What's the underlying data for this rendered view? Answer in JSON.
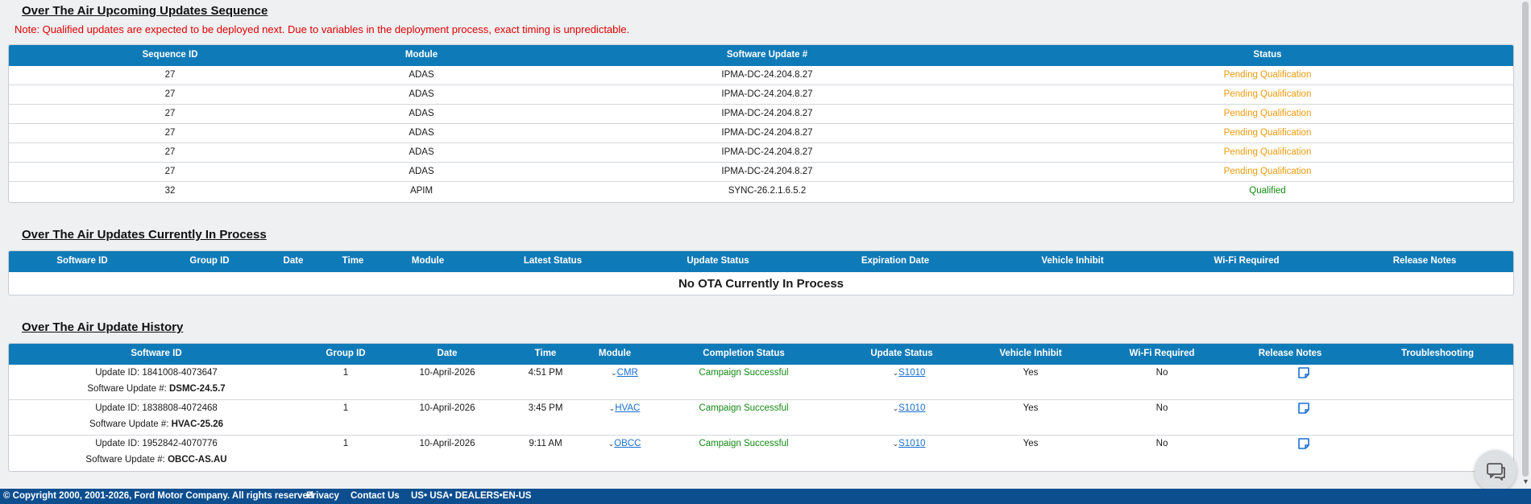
{
  "upcoming": {
    "title": "Over The Air Upcoming Updates Sequence",
    "note": "Note: Qualified updates are expected to be deployed next. Due to variables in the deployment process, exact timing is unpredictable.",
    "headers": [
      "Sequence ID",
      "Module",
      "Software Update #",
      "Status"
    ],
    "rows": [
      {
        "seq": "27",
        "module": "ADAS",
        "update": "IPMA-DC-24.204.8.27",
        "status": "Pending Qualification",
        "status_color": "#f09a0e"
      },
      {
        "seq": "27",
        "module": "ADAS",
        "update": "IPMA-DC-24.204.8.27",
        "status": "Pending Qualification",
        "status_color": "#f09a0e"
      },
      {
        "seq": "27",
        "module": "ADAS",
        "update": "IPMA-DC-24.204.8.27",
        "status": "Pending Qualification",
        "status_color": "#f09a0e"
      },
      {
        "seq": "27",
        "module": "ADAS",
        "update": "IPMA-DC-24.204.8.27",
        "status": "Pending Qualification",
        "status_color": "#f09a0e"
      },
      {
        "seq": "27",
        "module": "ADAS",
        "update": "IPMA-DC-24.204.8.27",
        "status": "Pending Qualification",
        "status_color": "#f09a0e"
      },
      {
        "seq": "27",
        "module": "ADAS",
        "update": "IPMA-DC-24.204.8.27",
        "status": "Pending Qualification",
        "status_color": "#f09a0e"
      },
      {
        "seq": "32",
        "module": "APIM",
        "update": "SYNC-26.2.1.6.5.2",
        "status": "Qualified",
        "status_color": "#148a14"
      }
    ]
  },
  "in_process": {
    "title": "Over The Air Updates Currently In Process",
    "headers": [
      "Software ID",
      "Group ID",
      "Date",
      "Time",
      "Module",
      "Latest Status",
      "Update Status",
      "Expiration Date",
      "Vehicle Inhibit",
      "Wi-Fi Required",
      "Release Notes"
    ],
    "empty_message": "No OTA Currently In Process"
  },
  "history": {
    "title": "Over The Air Update History",
    "headers": [
      "Software ID",
      "Group ID",
      "Date",
      "Time",
      "Module",
      "Completion Status",
      "Update Status",
      "Vehicle Inhibit",
      "Wi-Fi Required",
      "Release Notes",
      "Troubleshooting"
    ],
    "sw_prefix": "Software Update #:",
    "rows": [
      {
        "update_id": "Update ID: 1841008-4073647",
        "sw": "DSMC-24.5.7",
        "group": "1",
        "date": "10-April-2026",
        "time": "4:51 PM",
        "module": "CMR",
        "completion": "Campaign Successful",
        "update_status": "S1010",
        "inhibit": "Yes",
        "wifi": "No"
      },
      {
        "update_id": "Update ID: 1838808-4072468",
        "sw": "HVAC-25.26",
        "group": "1",
        "date": "10-April-2026",
        "time": "3:45 PM",
        "module": "HVAC",
        "completion": "Campaign Successful",
        "update_status": "S1010",
        "inhibit": "Yes",
        "wifi": "No"
      },
      {
        "update_id": "Update ID: 1952842-4070776",
        "sw": "OBCC-AS.AU",
        "group": "1",
        "date": "10-April-2026",
        "time": "9:11 AM",
        "module": "OBCC",
        "completion": "Campaign Successful",
        "update_status": "S1010",
        "inhibit": "Yes",
        "wifi": "No"
      }
    ]
  },
  "footer": {
    "copyright": "© Copyright 2000, 2001-2026, Ford Motor Company. All rights reserved",
    "privacy": "Privacy",
    "contact": "Contact Us",
    "locale": "US• USA• DEALERS•EN-US"
  },
  "colors": {
    "header_blue": "#0f7ab8",
    "pending": "#f09a0e",
    "success": "#148a14",
    "link": "#1a6fd1",
    "footer": "#0d4e8f",
    "note": "#e00000"
  },
  "icons": {
    "chat": "chat-icon",
    "release_notes": "document-icon",
    "expand": "chevron-down-icon"
  }
}
